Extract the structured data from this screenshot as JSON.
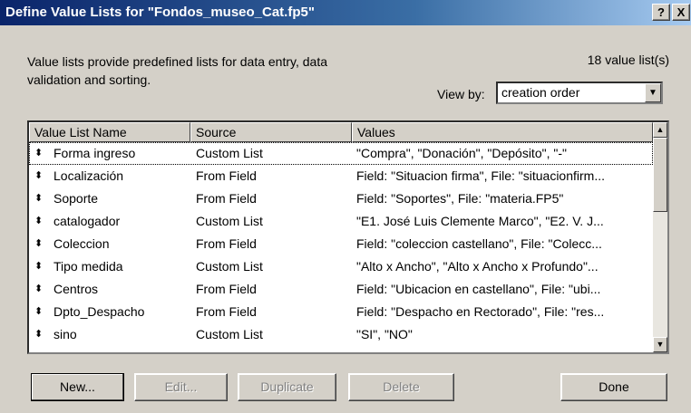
{
  "window": {
    "title": "Define Value Lists for \"Fondos_museo_Cat.fp5\"",
    "help_label": "?",
    "close_label": "X"
  },
  "description": "Value lists provide predefined lists for data entry, data validation and sorting.",
  "count_label": "18 value list(s)",
  "view_by": {
    "label": "View by:",
    "selected": "creation order"
  },
  "list": {
    "headers": [
      "Value List Name",
      "Source",
      "Values"
    ],
    "rows": [
      {
        "name": "Forma ingreso",
        "source": "Custom List",
        "values": "\"Compra\", \"Donación\", \"Depósito\", \"-\""
      },
      {
        "name": "Localización",
        "source": "From Field",
        "values": "Field: \"Situacion firma\", File: \"situacionfirm..."
      },
      {
        "name": "Soporte",
        "source": "From Field",
        "values": "Field: \"Soportes\", File: \"materia.FP5\""
      },
      {
        "name": "catalogador",
        "source": "Custom List",
        "values": "\"E1. José Luis Clemente Marco\", \"E2. V. J..."
      },
      {
        "name": "Coleccion",
        "source": "From Field",
        "values": "Field: \"coleccion castellano\", File: \"Colecc..."
      },
      {
        "name": "Tipo medida",
        "source": "Custom List",
        "values": "\"Alto x Ancho\", \"Alto x Ancho x Profundo\"..."
      },
      {
        "name": "Centros",
        "source": "From Field",
        "values": "Field: \"Ubicacion en castellano\", File: \"ubi..."
      },
      {
        "name": "Dpto_Despacho",
        "source": "From Field",
        "values": "Field: \"Despacho en Rectorado\", File: \"res..."
      },
      {
        "name": "sino",
        "source": "Custom List",
        "values": "\"SI\", \"NO\""
      }
    ]
  },
  "buttons": {
    "new": "New...",
    "edit": "Edit...",
    "duplicate": "Duplicate",
    "delete": "Delete",
    "done": "Done"
  },
  "icons": {
    "row_handle": "move-arrows-icon",
    "scroll_up": "scroll-up-icon",
    "scroll_down": "scroll-down-icon",
    "dropdown": "chevron-down-icon"
  },
  "colors": {
    "titlebar_start": "#0a246a",
    "titlebar_end": "#a6caf0",
    "face": "#d4d0c8"
  }
}
